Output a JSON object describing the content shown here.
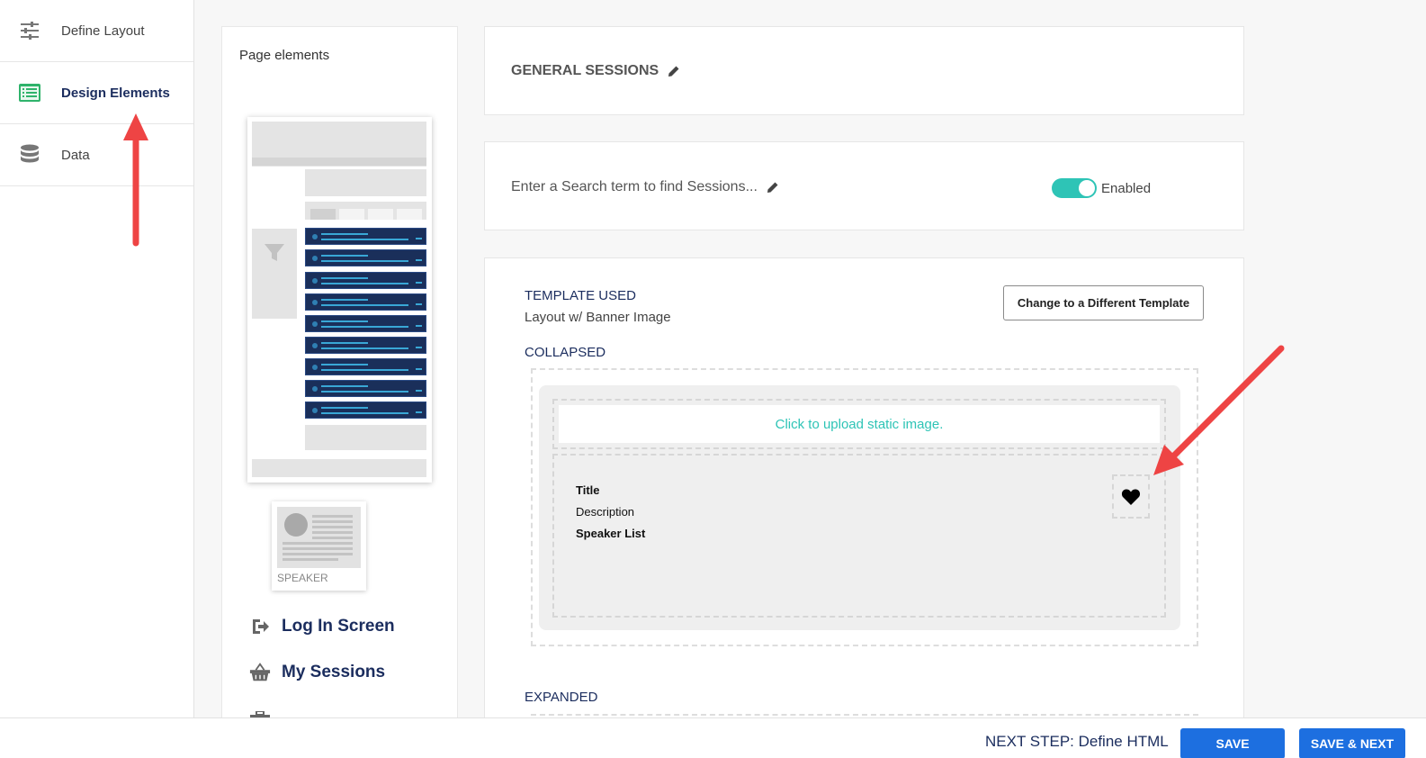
{
  "sidebar": {
    "items": [
      {
        "label": "Define Layout",
        "icon": "sliders-icon"
      },
      {
        "label": "Design Elements",
        "icon": "list-card-icon",
        "active": true
      },
      {
        "label": "Data",
        "icon": "database-icon"
      }
    ]
  },
  "page_elements": {
    "title": "Page elements",
    "speaker_label": "SPEAKER",
    "links": [
      {
        "label": "Log In Screen",
        "icon": "login-icon"
      },
      {
        "label": "My Sessions",
        "icon": "basket-icon"
      }
    ]
  },
  "general": {
    "title": "GENERAL SESSIONS"
  },
  "search": {
    "placeholder_text": "Enter a Search term to find Sessions...",
    "toggle_label": "Enabled",
    "toggle_on": true
  },
  "template": {
    "used_label": "TEMPLATE USED",
    "used_value": "Layout w/ Banner Image",
    "change_button": "Change to a Different Template",
    "collapsed_label": "COLLAPSED",
    "upload_text": "Click to upload static image.",
    "fields": [
      "Title",
      "Description",
      "Speaker List"
    ],
    "expanded_label": "EXPANDED"
  },
  "footer": {
    "next_step": "NEXT STEP: Define HTML",
    "save": "SAVE",
    "save_next": "SAVE & NEXT"
  },
  "colors": {
    "accent_teal": "#2ec4b6",
    "navy": "#1b2d5e",
    "primary_blue": "#1d6fe0",
    "arrow_red": "#ee4444"
  }
}
